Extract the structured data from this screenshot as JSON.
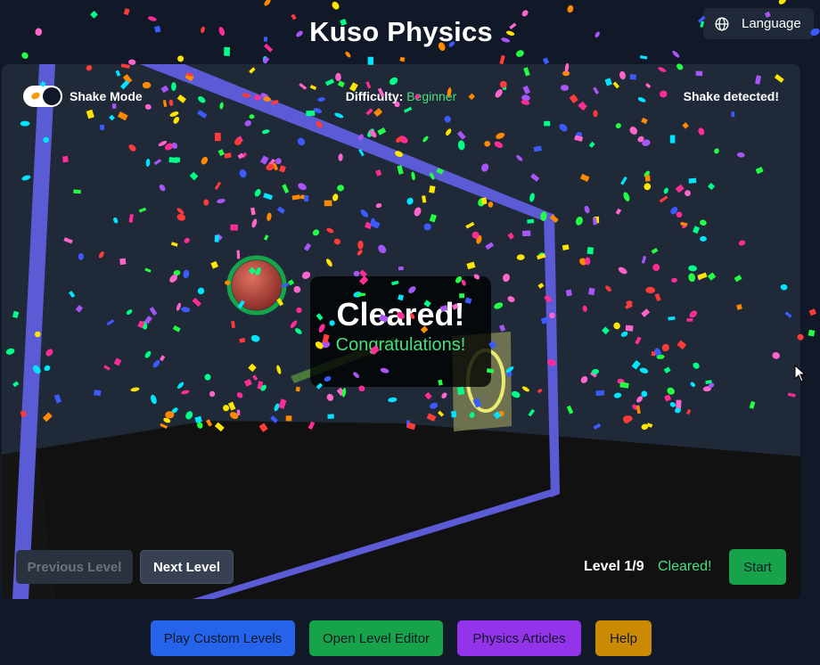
{
  "app": {
    "title": "Kuso Physics"
  },
  "header": {
    "language_label": "Language",
    "language_icon": "globe-icon"
  },
  "game": {
    "shake_mode_label": "Shake Mode",
    "shake_mode_on": true,
    "difficulty_label": "Difficulty:",
    "difficulty_value": "Beginner",
    "shake_status": "Shake detected!",
    "overlay": {
      "title": "Cleared!",
      "subtitle": "Congratulations!"
    },
    "prev_level_label": "Previous Level",
    "next_level_label": "Next Level",
    "level_indicator": "Level 1/9",
    "status": "Cleared!",
    "start_label": "Start"
  },
  "footer": {
    "buttons": [
      {
        "label": "Play Custom Levels",
        "color": "#2563eb"
      },
      {
        "label": "Open Level Editor",
        "color": "#16a34a"
      },
      {
        "label": "Physics Articles",
        "color": "#9333ea"
      },
      {
        "label": "Help",
        "color": "#ca8a04"
      }
    ]
  },
  "colors": {
    "background": "#111827",
    "panel": "#1f2937",
    "accent_green": "#4ade80",
    "wall": "#5b5bd6"
  }
}
